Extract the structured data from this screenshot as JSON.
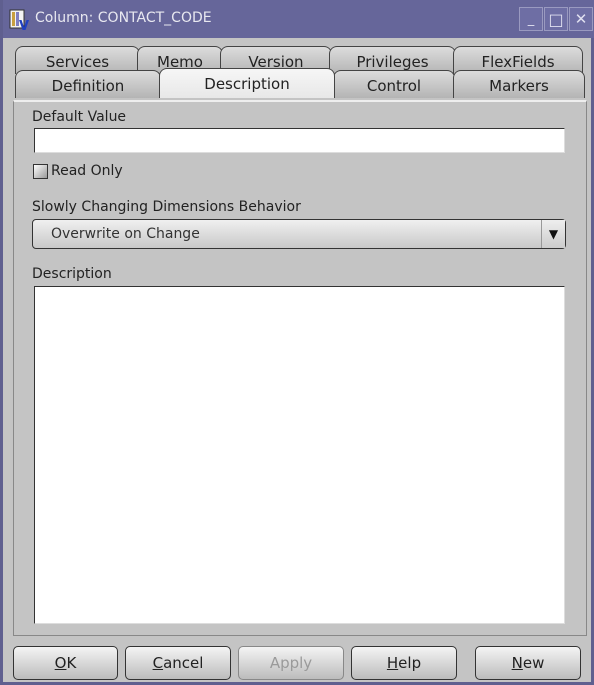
{
  "window": {
    "title": "Column: CONTACT_CODE",
    "icon": "app-column-icon",
    "controls": {
      "minimize": "_",
      "maximize": "□",
      "close": "✕"
    }
  },
  "tabs": {
    "row_back": [
      {
        "label": "Services"
      },
      {
        "label": "Memo"
      },
      {
        "label": "Version"
      },
      {
        "label": "Privileges"
      },
      {
        "label": "FlexFields"
      }
    ],
    "row_front": [
      {
        "label": "Definition"
      },
      {
        "label": "Description",
        "active": true
      },
      {
        "label": "Control"
      },
      {
        "label": "Markers"
      }
    ]
  },
  "form": {
    "default_value_label": "Default Value",
    "default_value": "",
    "read_only_label": "Read Only",
    "read_only_checked": false,
    "scd_label": "Slowly Changing Dimensions Behavior",
    "scd_selected": "Overwrite on Change",
    "description_label": "Description",
    "description_value": ""
  },
  "buttons": {
    "ok": {
      "mnemonic": "O",
      "rest": "K"
    },
    "cancel": {
      "mnemonic": "C",
      "rest": "ancel"
    },
    "apply": {
      "label": "Apply",
      "disabled": true
    },
    "help": {
      "mnemonic": "H",
      "rest": "elp"
    },
    "new": {
      "mnemonic": "N",
      "rest": "ew"
    }
  }
}
